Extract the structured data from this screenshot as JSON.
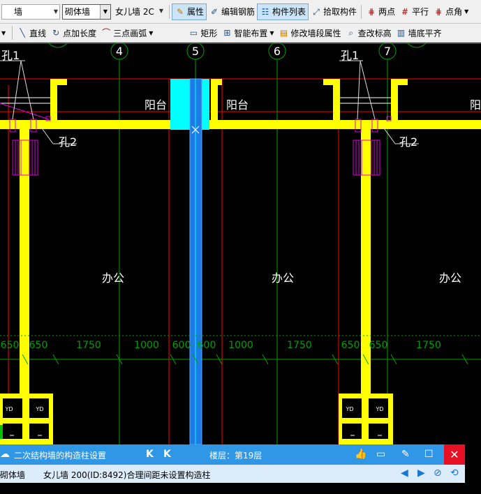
{
  "toolbar1": {
    "combo_type": "墙",
    "combo_material": "砌体墙",
    "combo_name": "女儿墙 2C",
    "btn_properties": "属性",
    "btn_edit_rebar": "编辑钢筋",
    "btn_component_list": "构件列表",
    "btn_pick": "拾取构件",
    "btn_two_points": "两点",
    "btn_parallel": "平行",
    "btn_point_angle": "点角"
  },
  "toolbar2": {
    "btn_line": "直线",
    "btn_point_length": "点加长度",
    "btn_three_arc": "三点画弧",
    "btn_rect": "矩形",
    "btn_smart": "智能布置",
    "btn_modify_seg": "修改墙段属性",
    "btn_check_elev": "查改标高",
    "btn_wall_bottom": "墙底平齐"
  },
  "canvas": {
    "axes": [
      "4",
      "5",
      "6",
      "7"
    ],
    "labels": {
      "hole1_left": "孔1",
      "hole1_right": "孔1",
      "hole2_left": "孔2",
      "hole2_right": "孔2",
      "balcony1": "阳台",
      "balcony2": "阳台",
      "balcony3": "阳",
      "office1": "办公",
      "office2": "办公",
      "office3": "办公"
    },
    "dimensions": [
      "650",
      "650",
      "1750",
      "1000",
      "600",
      "600",
      "1000",
      "1750",
      "650",
      "650",
      "1750"
    ],
    "col_label": "YD"
  },
  "panel": {
    "title": "二次结构墙的构造柱设置",
    "floor": "楼层：第19层"
  },
  "message_row": {
    "col1": "砌体墙",
    "col2": "女儿墙 200(ID:8492)合理间距未设置构造柱"
  },
  "colors": {
    "wall_yellow": "#ffff00",
    "axis_green": "#00a000",
    "grid_red": "#ff0000",
    "selected_blue": "#1e7be6",
    "cyan": "#00ffff",
    "magenta": "#e000e0",
    "panel_blue": "#2f97e6"
  }
}
